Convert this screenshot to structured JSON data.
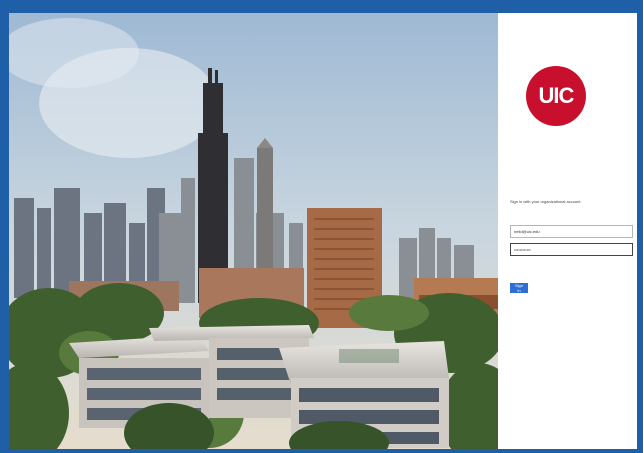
{
  "logo": {
    "text": "UIC",
    "color": "#c8102e"
  },
  "signin": {
    "prompt": "Sign in with your organizational account",
    "username_value": "netid@uic.edu",
    "password_value": "••••••••••••",
    "button_label": "Sign in"
  },
  "colors": {
    "frame": "#1f5fa8",
    "button": "#2f6fd3"
  }
}
